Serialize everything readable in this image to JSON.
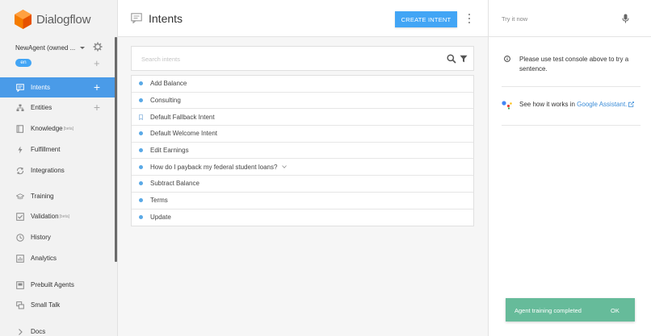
{
  "app": {
    "name": "Dialogflow",
    "brand_color": "#f57c00",
    "accent": "#42a5f5"
  },
  "sidebar": {
    "agent_name": "NewAgent (owned ...",
    "language": "en",
    "items": [
      {
        "label": "Intents",
        "icon": "chat-bubble-icon",
        "active": true,
        "has_add": true
      },
      {
        "label": "Entities",
        "icon": "entities-icon",
        "active": false,
        "has_add": true
      },
      {
        "label": "Knowledge",
        "beta": "[beta]",
        "icon": "knowledge-icon",
        "active": false
      },
      {
        "label": "Fulfillment",
        "icon": "bolt-icon",
        "active": false
      },
      {
        "label": "Integrations",
        "icon": "integrations-icon",
        "active": false
      },
      {
        "label": "Training",
        "icon": "graduation-cap-icon",
        "active": false
      },
      {
        "label": "Validation",
        "beta": "[beta]",
        "icon": "check-box-icon",
        "active": false
      },
      {
        "label": "History",
        "icon": "clock-icon",
        "active": false
      },
      {
        "label": "Analytics",
        "icon": "bar-chart-icon",
        "active": false
      },
      {
        "label": "Prebuilt Agents",
        "icon": "prebuilt-agents-icon",
        "active": false
      },
      {
        "label": "Small Talk",
        "icon": "small-talk-icon",
        "active": false
      },
      {
        "label": "Docs",
        "icon": "chevron-right-icon",
        "active": false
      }
    ]
  },
  "header": {
    "title": "Intents",
    "create_button": "CREATE INTENT"
  },
  "search": {
    "placeholder": "Search intents"
  },
  "intents": [
    {
      "label": "Add Balance",
      "marker": "dot"
    },
    {
      "label": "Consulting",
      "marker": "dot"
    },
    {
      "label": "Default Fallback Intent",
      "marker": "bookmark"
    },
    {
      "label": "Default Welcome Intent",
      "marker": "dot"
    },
    {
      "label": "Edit Earnings",
      "marker": "dot"
    },
    {
      "label": "How do I payback my federal student loans?",
      "marker": "dot",
      "expandable": true
    },
    {
      "label": "Subtract Balance",
      "marker": "dot"
    },
    {
      "label": "Terms",
      "marker": "dot"
    },
    {
      "label": "Update",
      "marker": "dot"
    }
  ],
  "right_panel": {
    "try_placeholder": "Try it now",
    "info_text": "Please use test console above to try a sentence.",
    "assistant_prefix": "See how it works in ",
    "assistant_link": "Google Assistant."
  },
  "toast": {
    "message": "Agent training completed",
    "action": "OK"
  }
}
